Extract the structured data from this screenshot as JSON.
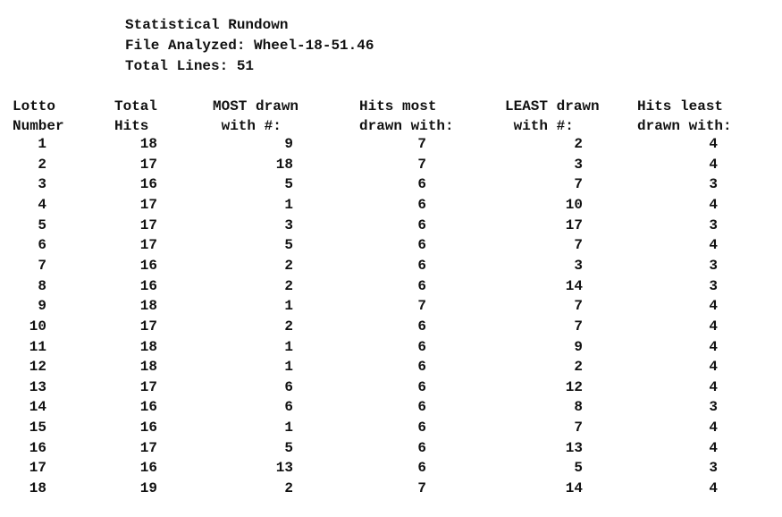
{
  "header": {
    "title": "Statistical Rundown",
    "file_analyzed": "File Analyzed: Wheel-18-51.46",
    "total_lines": "Total Lines: 51"
  },
  "columns": [
    {
      "line1": "Lotto",
      "line2": "Number"
    },
    {
      "line1": "Total",
      "line2": "Hits"
    },
    {
      "line1": "MOST drawn",
      "line2": " with #:"
    },
    {
      "line1": "Hits most",
      "line2": "drawn with:"
    },
    {
      "line1": "LEAST drawn",
      "line2": " with #:"
    },
    {
      "line1": "Hits least",
      "line2": "drawn with:"
    }
  ],
  "rows": [
    [
      "1",
      "18",
      "9",
      "7",
      "2",
      "4"
    ],
    [
      "2",
      "17",
      "18",
      "7",
      "3",
      "4"
    ],
    [
      "3",
      "16",
      "5",
      "6",
      "7",
      "3"
    ],
    [
      "4",
      "17",
      "1",
      "6",
      "10",
      "4"
    ],
    [
      "5",
      "17",
      "3",
      "6",
      "17",
      "3"
    ],
    [
      "6",
      "17",
      "5",
      "6",
      "7",
      "4"
    ],
    [
      "7",
      "16",
      "2",
      "6",
      "3",
      "3"
    ],
    [
      "8",
      "16",
      "2",
      "6",
      "14",
      "3"
    ],
    [
      "9",
      "18",
      "1",
      "7",
      "7",
      "4"
    ],
    [
      "10",
      "17",
      "2",
      "6",
      "7",
      "4"
    ],
    [
      "11",
      "18",
      "1",
      "6",
      "9",
      "4"
    ],
    [
      "12",
      "18",
      "1",
      "6",
      "2",
      "4"
    ],
    [
      "13",
      "17",
      "6",
      "6",
      "12",
      "4"
    ],
    [
      "14",
      "16",
      "6",
      "6",
      "8",
      "3"
    ],
    [
      "15",
      "16",
      "1",
      "6",
      "7",
      "4"
    ],
    [
      "16",
      "17",
      "5",
      "6",
      "13",
      "4"
    ],
    [
      "17",
      "16",
      "13",
      "6",
      "5",
      "3"
    ],
    [
      "18",
      "19",
      "2",
      "7",
      "14",
      "4"
    ]
  ]
}
